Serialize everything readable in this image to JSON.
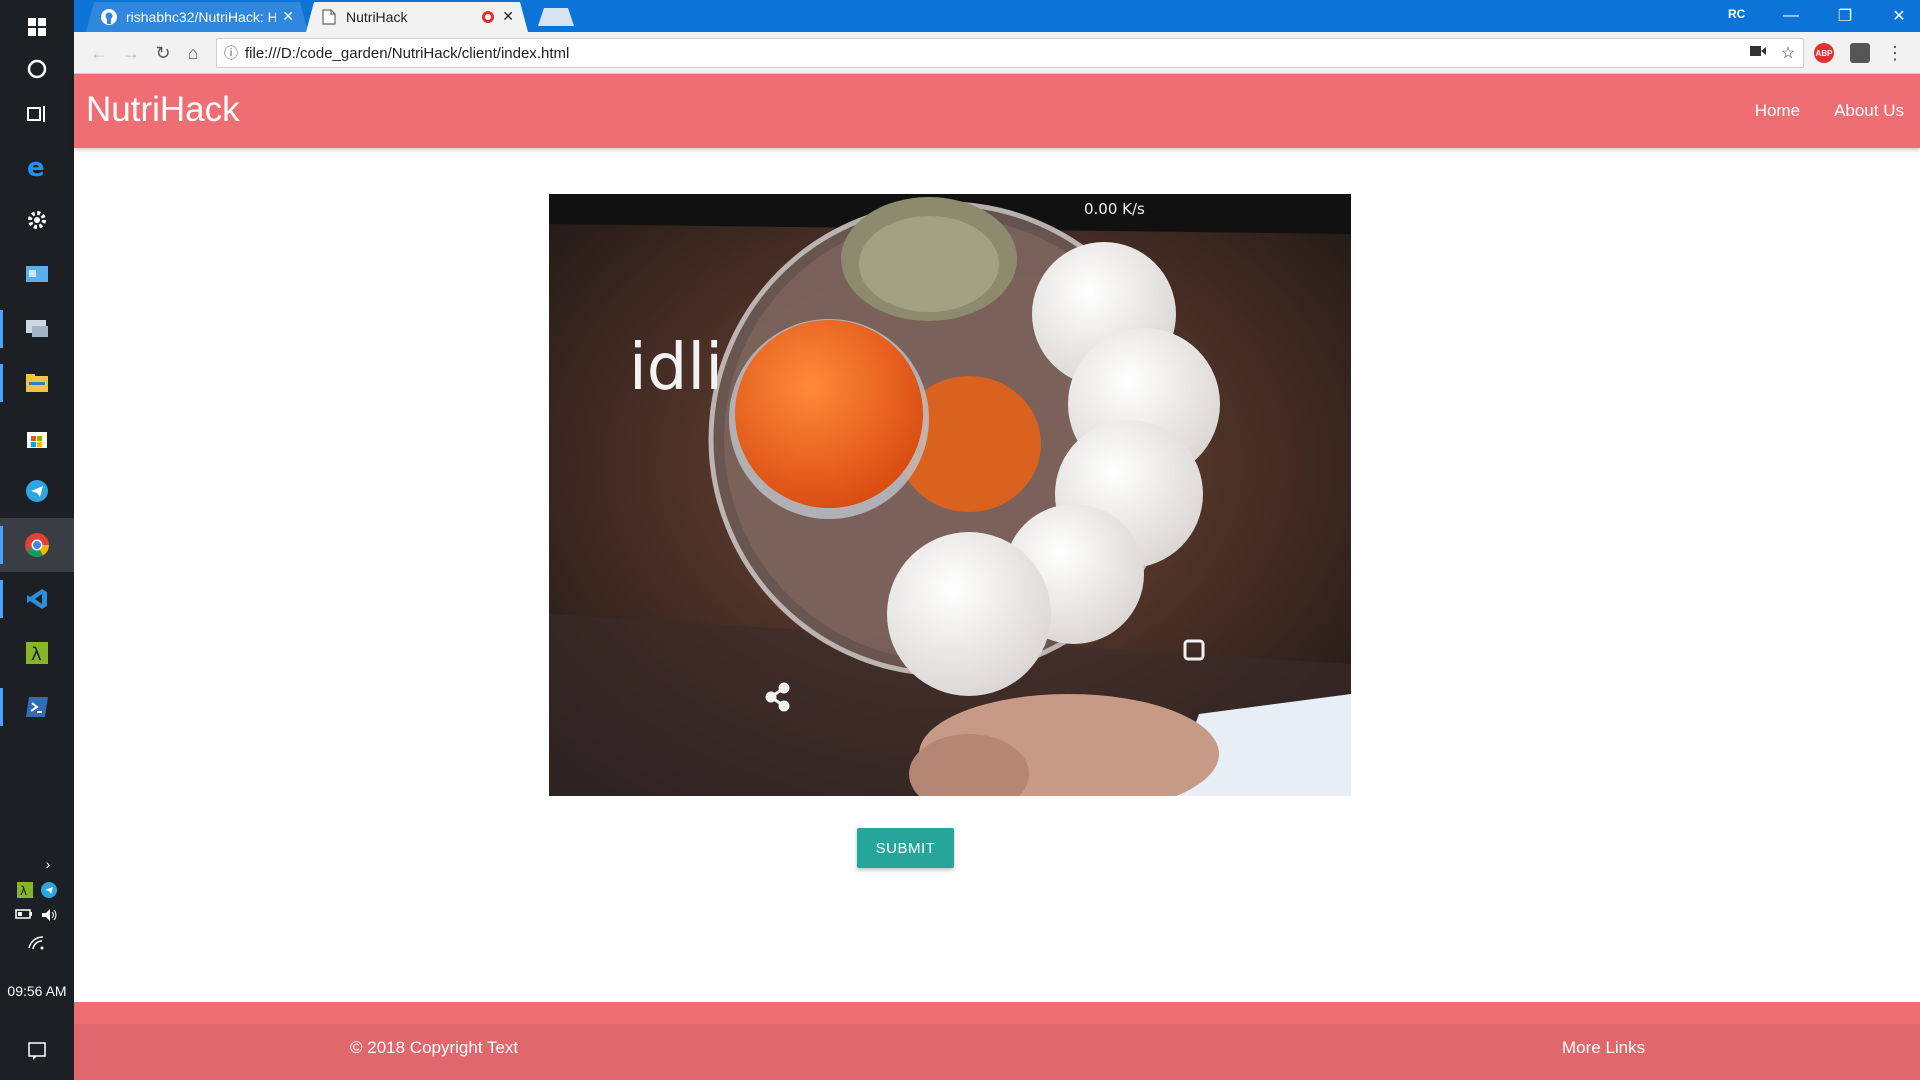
{
  "taskbar": {
    "clock": "09:56 AM"
  },
  "browser": {
    "tabs": [
      {
        "title": "rishabhc32/NutriHack: Ha"
      },
      {
        "title": "NutriHack"
      }
    ],
    "profile": "RC",
    "url": "file:///D:/code_garden/NutriHack/client/index.html",
    "extensions": {
      "adblock": "ABP"
    }
  },
  "navbar": {
    "brand": "NutriHack",
    "links": [
      {
        "label": "Home"
      },
      {
        "label": "About Us"
      }
    ]
  },
  "photo": {
    "caption_text": "idli",
    "status_text": "0.00 K/s"
  },
  "form": {
    "submit_label": "SUBMIT"
  },
  "footer": {
    "copyright": "© 2018 Copyright Text",
    "more_links": "More Links"
  },
  "colors": {
    "brand_red": "#ef6e73",
    "submit_teal": "#26a69a",
    "chrome_blue": "#0b74d6"
  }
}
